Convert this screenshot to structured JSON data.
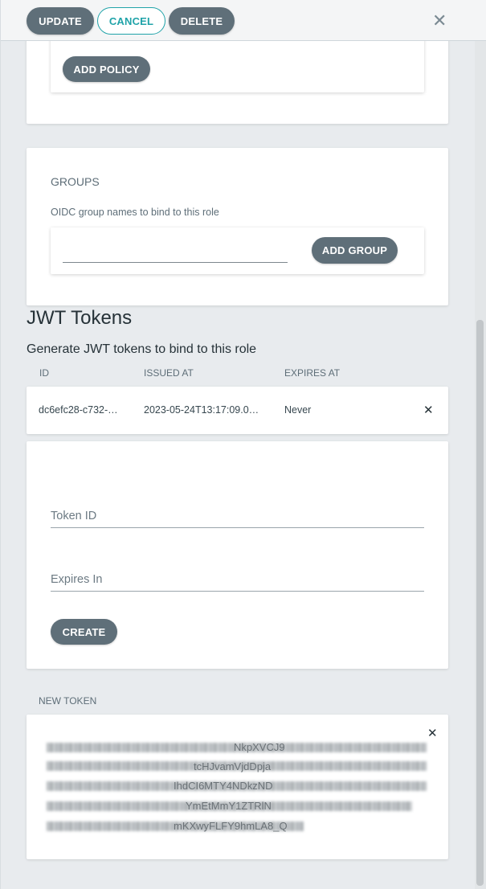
{
  "toolbar": {
    "update_label": "UPDATE",
    "cancel_label": "CANCEL",
    "delete_label": "DELETE",
    "close_glyph": "✕"
  },
  "policies": {
    "add_policy_label": "ADD POLICY"
  },
  "groups": {
    "title": "GROUPS",
    "description": "OIDC group names to bind to this role",
    "add_group_label": "ADD GROUP",
    "input_value": ""
  },
  "jwt": {
    "title": "JWT Tokens",
    "subtitle": "Generate JWT tokens to bind to this role",
    "columns": [
      "ID",
      "ISSUED AT",
      "EXPIRES AT"
    ],
    "rows": [
      {
        "id": "dc6efc28-c732-…",
        "issued_at": "2023-05-24T13:17:09.0…",
        "expires_at": "Never",
        "remove_glyph": "✕"
      }
    ]
  },
  "create_form": {
    "token_id_label": "Token ID",
    "expires_in_label": "Expires In",
    "create_label": "CREATE"
  },
  "new_token": {
    "title": "NEW TOKEN",
    "close_glyph": "✕",
    "visible_fragments": [
      "NkpXVCJ9",
      "tcHJvamVjdDpja",
      "IhdCI6MTY4NDkzND",
      "YmEtMmY1ZTRlN",
      "mKXwyFLFY9hmLA8_Q"
    ]
  },
  "colors": {
    "primary_button": "#5f6f79",
    "accent": "#20a3a9",
    "background": "#e8ebee",
    "card": "#ffffff"
  },
  "icons": {
    "close": "close-icon",
    "remove": "remove-icon"
  }
}
